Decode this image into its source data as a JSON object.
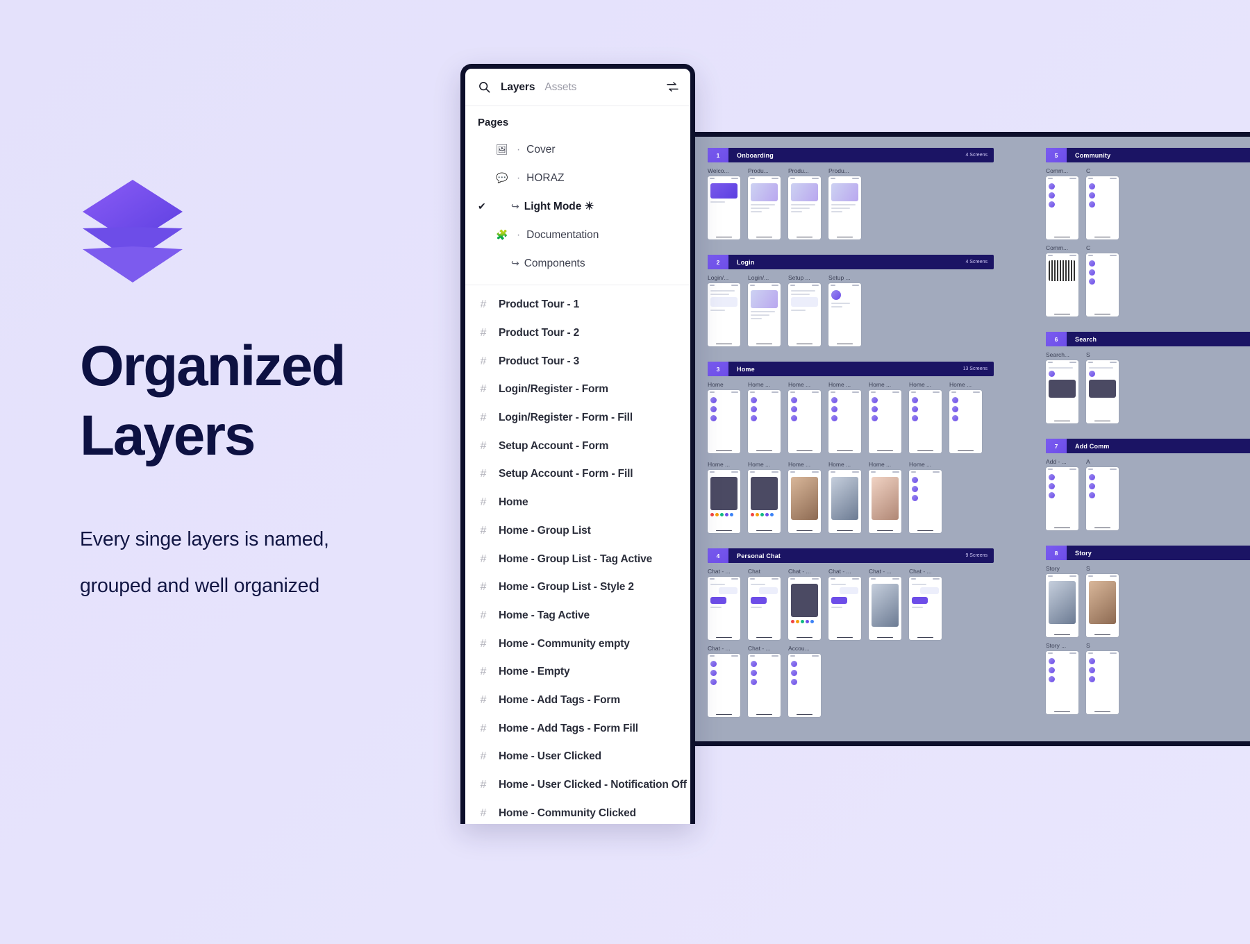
{
  "promo": {
    "logo_icon": "layers-stack-logo",
    "title": "Organized\nLayers",
    "subtitle": "Every singe layers is named,\ngrouped and well organized",
    "title_color": "#0d1142",
    "background_color": "#e6e3fc",
    "accent_color": "#6d4de8"
  },
  "panel": {
    "search_icon": "search-icon",
    "tab_layers": "Layers",
    "tab_assets": "Assets",
    "collapse_icon": "arrow-swap-icon",
    "pages_heading": "Pages",
    "pages": [
      {
        "check": "",
        "icon": "image-icon",
        "glyph": "🖼",
        "dot": "·",
        "arrow": "",
        "label": "Cover",
        "current": false
      },
      {
        "check": "",
        "icon": "speech-bubble-icon",
        "glyph": "💬",
        "dot": "·",
        "arrow": "",
        "label": "HORAZ",
        "current": false
      },
      {
        "check": "✔",
        "icon": "",
        "glyph": "",
        "dot": "",
        "arrow": "↪",
        "label": "Light Mode ☀",
        "current": true
      },
      {
        "check": "",
        "icon": "puzzle-icon",
        "glyph": "🧩",
        "dot": "·",
        "arrow": "",
        "label": "Documentation",
        "current": false
      },
      {
        "check": "",
        "icon": "",
        "glyph": "",
        "dot": "",
        "arrow": "↪",
        "label": "Components",
        "current": false
      }
    ],
    "layer_icon": "frame-icon",
    "layers": [
      "Product Tour - 1",
      "Product Tour - 2",
      "Product Tour - 3",
      "Login/Register - Form",
      "Login/Register - Form - Fill",
      "Setup Account - Form",
      "Setup Account - Form - Fill",
      "Home",
      "Home - Group List",
      "Home - Group List - Tag Active",
      "Home - Group List - Style 2",
      "Home - Tag Active",
      "Home - Community empty",
      "Home - Empty",
      "Home - Add Tags - Form",
      "Home - Add Tags - Form Fill",
      "Home - User Clicked",
      "Home - User Clicked - Notification Off",
      "Home - Community Clicked"
    ]
  },
  "canvas": {
    "background_color": "#a2aabd",
    "section_bar_color": "#1b1464",
    "section_badge_color": "#6d4de8",
    "columns": [
      {
        "id": "col-a",
        "sections": [
          {
            "number": "1",
            "label": "Onboarding",
            "count": "4 Screens",
            "frames": [
              {
                "name": "Welco...",
                "style": "logo"
              },
              {
                "name": "Produ...",
                "style": "illus"
              },
              {
                "name": "Produ...",
                "style": "illus"
              },
              {
                "name": "Produ...",
                "style": "illus"
              }
            ]
          },
          {
            "number": "2",
            "label": "Login",
            "count": "4 Screens",
            "frames": [
              {
                "name": "Login/...",
                "style": "form"
              },
              {
                "name": "Login/...",
                "style": "illus"
              },
              {
                "name": "Setup ...",
                "style": "form"
              },
              {
                "name": "Setup ...",
                "style": "avatar"
              }
            ]
          },
          {
            "number": "3",
            "label": "Home",
            "count": "13 Screens",
            "frames": [
              {
                "name": "Home",
                "style": "list"
              },
              {
                "name": "Home ...",
                "style": "list"
              },
              {
                "name": "Home ...",
                "style": "list"
              },
              {
                "name": "Home ...",
                "style": "list"
              },
              {
                "name": "Home ...",
                "style": "list"
              },
              {
                "name": "Home ...",
                "style": "list"
              },
              {
                "name": "Home ...",
                "style": "list"
              },
              {
                "name": "Home ...",
                "style": "dark"
              },
              {
                "name": "Home ...",
                "style": "dark"
              },
              {
                "name": "Home ...",
                "style": "photoA"
              },
              {
                "name": "Home ...",
                "style": "photoB"
              },
              {
                "name": "Home ...",
                "style": "photoC"
              },
              {
                "name": "Home ...",
                "style": "list"
              }
            ]
          },
          {
            "number": "4",
            "label": "Personal Chat",
            "count": "9 Screens",
            "frames": [
              {
                "name": "Chat - ...",
                "style": "chat"
              },
              {
                "name": "Chat",
                "style": "chat"
              },
              {
                "name": "Chat - ...",
                "style": "dark"
              },
              {
                "name": "Chat - ...",
                "style": "chat"
              },
              {
                "name": "Chat - ...",
                "style": "photoB"
              },
              {
                "name": "Chat - ...",
                "style": "chat"
              }
            ],
            "frames_row2": [
              {
                "name": "Chat - ...",
                "style": ""
              },
              {
                "name": "Chat - ...",
                "style": ""
              },
              {
                "name": "Accou...",
                "style": ""
              }
            ]
          }
        ]
      },
      {
        "id": "col-b",
        "sections": [
          {
            "number": "5",
            "label": "Community",
            "count": "",
            "frames": [
              {
                "name": "Comm...",
                "style": "list"
              },
              {
                "name": "C",
                "style": "list"
              }
            ],
            "frames_row2": [
              {
                "name": "Comm...",
                "style": "qr"
              },
              {
                "name": "C",
                "style": "list"
              }
            ]
          },
          {
            "number": "6",
            "label": "Search",
            "count": "",
            "frames": [
              {
                "name": "Search...",
                "style": "search"
              },
              {
                "name": "S",
                "style": "search"
              }
            ]
          },
          {
            "number": "7",
            "label": "Add Comm",
            "count": "",
            "frames": [
              {
                "name": "Add - ...",
                "style": "list"
              },
              {
                "name": "A",
                "style": "list"
              }
            ]
          },
          {
            "number": "8",
            "label": "Story",
            "count": "",
            "frames": [
              {
                "name": "Story",
                "style": "photoB"
              },
              {
                "name": "S",
                "style": "photoA"
              }
            ],
            "frames_row2": [
              {
                "name": "Story ...",
                "style": ""
              },
              {
                "name": "S",
                "style": ""
              }
            ]
          }
        ]
      }
    ]
  }
}
